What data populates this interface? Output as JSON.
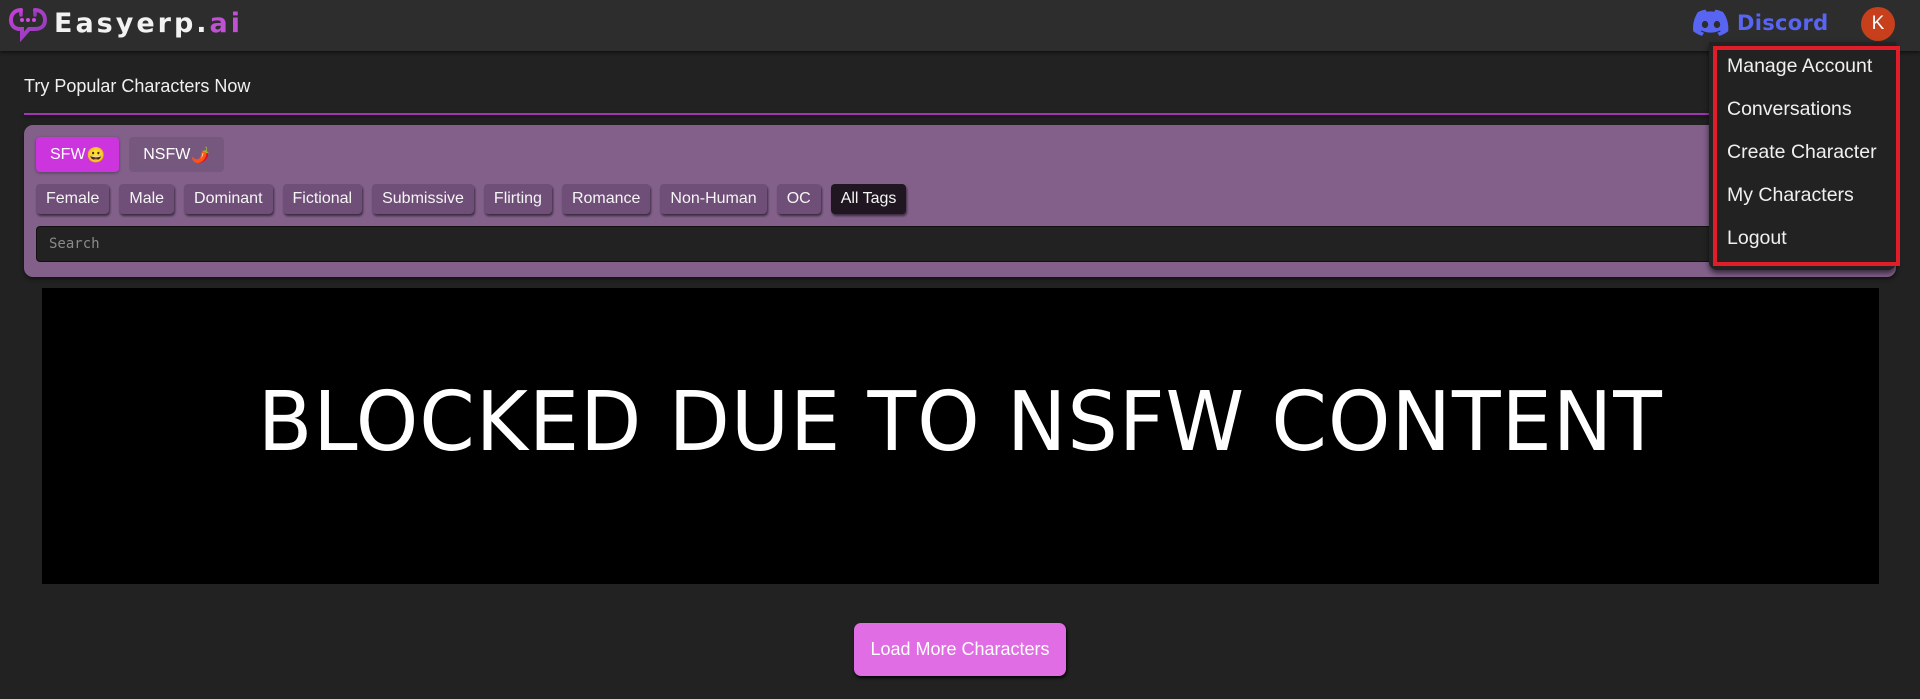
{
  "navbar": {
    "brand_name": "Easyerp.",
    "brand_suffix": "ai",
    "logo_icon": "chat-bubble-logo-icon",
    "discord_label": "Discord",
    "discord_icon": "discord-icon",
    "avatar_initial": "K"
  },
  "account_menu": {
    "items": [
      {
        "label": "Manage Account"
      },
      {
        "label": "Conversations"
      },
      {
        "label": "Create Character"
      },
      {
        "label": "My Characters"
      },
      {
        "label": "Logout"
      }
    ]
  },
  "main": {
    "section_title": "Try Popular Characters Now",
    "modes": [
      {
        "label": "SFW",
        "emoji": "😀",
        "active": true
      },
      {
        "label": "NSFW",
        "emoji": "🌶️",
        "active": false
      }
    ],
    "tags": [
      {
        "label": "Female"
      },
      {
        "label": "Male"
      },
      {
        "label": "Dominant"
      },
      {
        "label": "Fictional"
      },
      {
        "label": "Submissive"
      },
      {
        "label": "Flirting"
      },
      {
        "label": "Romance"
      },
      {
        "label": "Non-Human"
      },
      {
        "label": "OC"
      },
      {
        "label": "All Tags"
      }
    ],
    "search": {
      "placeholder": "Search",
      "value": ""
    },
    "blocked_message": "BLOCKED DUE TO NSFW CONTENT",
    "load_more_label": "Load More Characters"
  },
  "colors": {
    "accent": "#cc35de",
    "panel": "#82608a",
    "load_more": "#e06de3",
    "discord": "#5865f2",
    "avatar": "#c8401b",
    "highlight_border": "#e01d28"
  }
}
